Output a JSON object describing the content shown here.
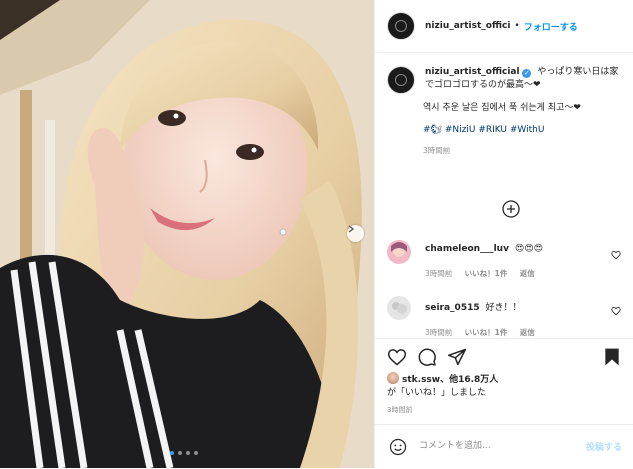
{
  "header": {
    "username": "niziu_artist_offici",
    "separator": "•",
    "follow_label": "フォローする"
  },
  "caption": {
    "username": "niziu_artist_official",
    "verified_mark": "✓",
    "text_ja": "やっぱり寒い日は家でゴロゴロするのが最高〜❤",
    "text_ko": "역시 추운 날은 집에서 푹 쉬는게 최고〜❤",
    "tags": [
      "#🐿",
      "#NiziU",
      "#RIKU",
      "#WithU"
    ],
    "time": "3時間前"
  },
  "comments": [
    {
      "username": "chameleon___luv",
      "text": "😍😍😍",
      "time": "3時間前",
      "likes": "いいね！1件",
      "reply": "返信"
    },
    {
      "username": "seira_0515",
      "text": "好き！！",
      "time": "3時間前",
      "likes": "いいね！1件",
      "reply": "返信"
    }
  ],
  "likes": {
    "user": "stk.ssw",
    "others": "、他16.8万人",
    "suffix": "が「いいね！」しました"
  },
  "post_time": "3時間前",
  "add_comment": {
    "placeholder": "コメントを追加...",
    "post_label": "投稿する"
  },
  "carousel": {
    "total": 4,
    "current": 1
  },
  "colors": {
    "accent": "#0095f6",
    "post_disabled": "#b2dffc",
    "muted": "#8e8e8e"
  }
}
